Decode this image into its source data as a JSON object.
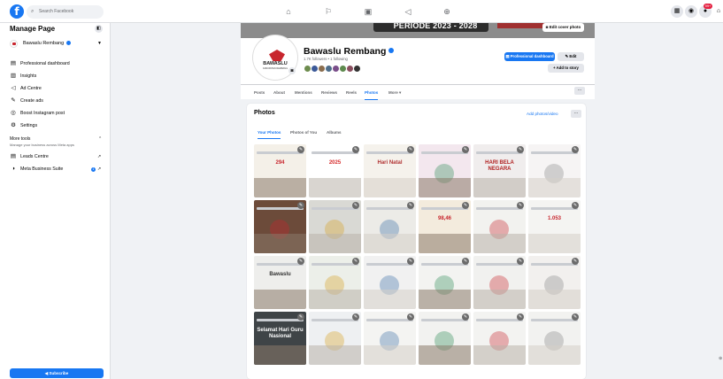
{
  "topbar": {
    "logo": "f",
    "search_placeholder": "Search Facebook",
    "nav_icons": [
      "home-icon",
      "flag-icon",
      "video-icon",
      "megaphone-icon",
      "gaming-icon"
    ],
    "notification_count": "99+"
  },
  "left_panel": {
    "title": "Manage Page",
    "account_name": "Bawaslu Rembang",
    "items": [
      {
        "label": "Professional dashboard",
        "icon": "dashboard-icon"
      },
      {
        "label": "Insights",
        "icon": "insights-icon"
      },
      {
        "label": "Ad Centre",
        "icon": "megaphone-icon"
      },
      {
        "label": "Create ads",
        "icon": "pencil-icon"
      },
      {
        "label": "Boost Instagram post",
        "icon": "instagram-icon"
      },
      {
        "label": "Settings",
        "icon": "gear-icon"
      }
    ],
    "more_tools_title": "More tools",
    "more_tools_subtitle": "Manage your business across Meta apps",
    "tools": [
      {
        "label": "Leads Centre",
        "icon": "leads-icon"
      },
      {
        "label": "Meta Business Suite",
        "icon": "meta-icon",
        "badge": "1"
      }
    ],
    "subscribe_label": "Subscribe"
  },
  "cover": {
    "banner_text": "PERIODE 2023 - 2028",
    "edit_label": "Edit cover photo"
  },
  "profile": {
    "logo_text": "BAWASLU",
    "logo_subtext": "KABUPATEN REMBANG",
    "name": "Bawaslu Rembang",
    "followers": "1.7K followers • 1 following",
    "btn_dashboard": "Professional dashboard",
    "btn_edit": "Edit",
    "btn_more": "+ Add to story"
  },
  "page_tabs": [
    "Posts",
    "About",
    "Mentions",
    "Reviews",
    "Reels",
    "Photos",
    "More ▾"
  ],
  "photos": {
    "title": "Photos",
    "add_label": "Add photos/video",
    "tabs": [
      "Your Photos",
      "Photos of You",
      "Albums"
    ],
    "tiles": [
      {
        "bg": "#f4f0e8",
        "caption": "294",
        "cap_color": "#c8262e"
      },
      {
        "bg": "#ffffff",
        "caption": "2025",
        "cap_color": "#d62b2b"
      },
      {
        "bg": "#f5f2ec",
        "caption": "Hari Natal",
        "cap_color": "#b03030"
      },
      {
        "bg": "#f3e7ee",
        "caption": "",
        "cap_color": "#a0407a"
      },
      {
        "bg": "#f0eded",
        "caption": "HARI BELA NEGARA",
        "cap_color": "#b02020"
      },
      {
        "bg": "#f6f4f4",
        "caption": "",
        "cap_color": "#c8262e"
      },
      {
        "bg": "#6c4b3a",
        "caption": "",
        "cap_color": "#fff"
      },
      {
        "bg": "#d9d9d4",
        "caption": "",
        "cap_color": "#333"
      },
      {
        "bg": "#ecebe7",
        "caption": "",
        "cap_color": "#333"
      },
      {
        "bg": "#f3ebdd",
        "caption": "98,46",
        "cap_color": "#c8262e"
      },
      {
        "bg": "#f2f2ef",
        "caption": "",
        "cap_color": "#333"
      },
      {
        "bg": "#f4f4f2",
        "caption": "1.053",
        "cap_color": "#c8262e"
      },
      {
        "bg": "#eeeeec",
        "caption": "Bawaslu",
        "cap_color": "#333"
      },
      {
        "bg": "#ecefe9",
        "caption": "",
        "cap_color": "#333"
      },
      {
        "bg": "#f1f1f1",
        "caption": "",
        "cap_color": "#333"
      },
      {
        "bg": "#f3f3f1",
        "caption": "",
        "cap_color": "#c8262e"
      },
      {
        "bg": "#f1f1ef",
        "caption": "",
        "cap_color": "#333"
      },
      {
        "bg": "#f2f0ee",
        "caption": "",
        "cap_color": "#333"
      },
      {
        "bg": "#3f4447",
        "caption": "Selamat Hari Guru Nasional",
        "cap_color": "#fff"
      },
      {
        "bg": "#eef0f2",
        "caption": "",
        "cap_color": "#333"
      },
      {
        "bg": "#f4f4f2",
        "caption": "",
        "cap_color": "#333"
      },
      {
        "bg": "#f2f2f0",
        "caption": "",
        "cap_color": "#333"
      },
      {
        "bg": "#f3f3f1",
        "caption": "",
        "cap_color": "#333"
      },
      {
        "bg": "#f2f2f0",
        "caption": "",
        "cap_color": "#333"
      }
    ]
  }
}
